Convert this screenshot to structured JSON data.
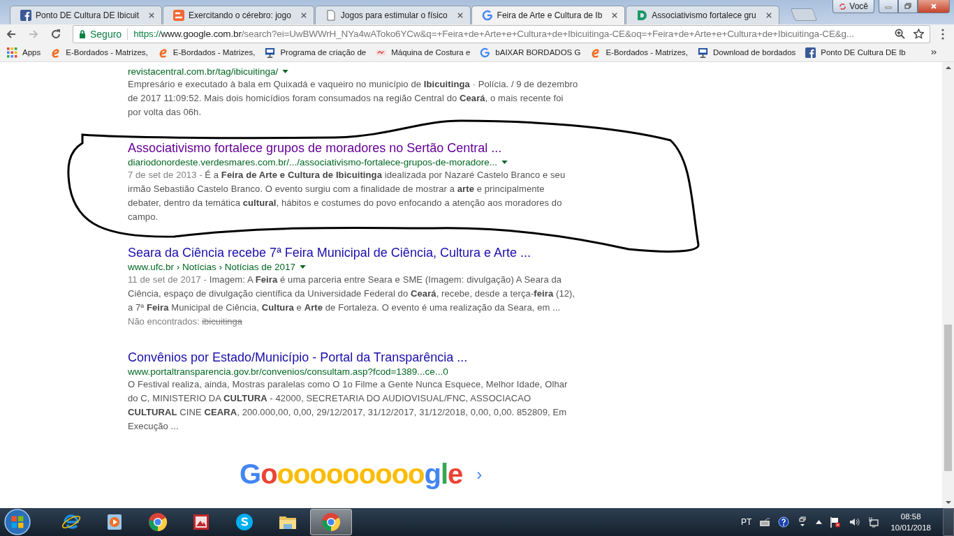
{
  "tabs": [
    {
      "title": "Ponto DE Cultura DE Ibicuit",
      "kind": "facebook",
      "selected": false
    },
    {
      "title": "Exercitando o cérebro: jogo",
      "kind": "blogger",
      "selected": false
    },
    {
      "title": "Jogos para estimular o físico",
      "kind": "page",
      "selected": false
    },
    {
      "title": "Feira de Arte e Cultura de Ib",
      "kind": "google",
      "selected": true
    },
    {
      "title": "Associativismo fortalece gru",
      "kind": "letter",
      "selected": false
    }
  ],
  "profile": {
    "label": "Você"
  },
  "omnibox": {
    "secure_label": "Seguro",
    "scheme": "https://",
    "host": "www.google.com.br",
    "path": "/search?ei=UwBWWrH_NYa4wAToko6YCw&q=+Feira+de+Arte+e+Cultura+de+Ibicuitinga-CE&oq=+Feira+de+Arte+e+Cultura+de+Ibicuitinga-CE&g..."
  },
  "bookmarks": [
    {
      "label": "Apps",
      "kind": "apps"
    },
    {
      "label": "E-Bordados - Matrizes,",
      "kind": "eletter"
    },
    {
      "label": "E-Bordados - Matrizes,",
      "kind": "eletter"
    },
    {
      "label": "Programa de criação de",
      "kind": "monitor"
    },
    {
      "label": "Máquina de Costura e",
      "kind": "sewing"
    },
    {
      "label": "bAIXAR BORDADOS G",
      "kind": "google"
    },
    {
      "label": "E-Bordados - Matrizes,",
      "kind": "eletter"
    },
    {
      "label": "Download de bordados",
      "kind": "monitor"
    },
    {
      "label": "Ponto DE Cultura DE Ib",
      "kind": "facebook"
    }
  ],
  "results": [
    {
      "url": "revistacentral.com.br/tag/ibicuitinga/",
      "menu_arrow": true,
      "snippet": "Empresário e executado à bala em Quixadá e vaqueiro no município de **Ibicuitinga** · Polícia. / 9 de dezembro de 2017 11:09:52. Mais dois homicídios foram consumados na região Central do **Ceará**, o mais recente foi por volta das 06h."
    },
    {
      "title": "Associativismo fortalece grupos de moradores no Sertão Central ...",
      "visited": true,
      "url": "diariodonordeste.verdesmares.com.br/.../associativismo-fortalece-grupos-de-moradore...",
      "menu_arrow": true,
      "date": "7 de set de 2013 - ",
      "snippet": "É a **Feira de Arte e Cultura de Ibicuitinga** idealizada por Nazaré Castelo Branco e seu irmão Sebastião Castelo Branco. O evento surgiu com a finalidade de mostrar a **arte** e principalmente debater, dentro da temática **cultural**, hábitos e costumes do povo enfocando a atenção aos moradores do campo."
    },
    {
      "title": "Seara da Ciência recebe 7ª Feira Municipal de Ciência, Cultura e Arte ...",
      "visited": false,
      "url": "www.ufc.br › Notícias › Notícias de 2017",
      "menu_arrow": true,
      "date": "11 de set de 2017 - ",
      "snippet": "Imagem: A **Feira** é uma parceria entre Seara e SME (Imagem: divulgação) A Seara da Ciência, espaço de divulgação científica da Universidade Federal do **Ceará**, recebe, desde a terça-**feira** (12), a 7ª **Feira** Municipal de Ciência, **Cultura** e **Arte** de Fortaleza. O evento é uma realização da Seara, em ...",
      "missing": {
        "label": "Não encontrados:",
        "term": "ibicuitinga"
      }
    },
    {
      "title": "Convênios por Estado/Município - Portal da Transparência ...",
      "visited": false,
      "url": "www.portaltransparencia.gov.br/convenios/consultam.asp?fcod=1389...ce...0",
      "menu_arrow": false,
      "snippet": "O Festival realiza, ainda, Mostras paralelas como O 1o Filme a Gente Nunca Esquece, Melhor Idade, Olhar do C, MINISTERIO DA **CULTURA** - 42000, SECRETARIA DO AUDIOVISUAL/FNC, ASSOCIACAO **CULTURAL** CINE **CEARA**, 200.000,00, 0,00, 29/12/2017, 31/12/2017, 31/12/2018, 0,00, 0,00. 852809, Em Execução ..."
    }
  ],
  "pager": {
    "logo": "Goooooooooogle",
    "next": "›"
  },
  "taskbar": {
    "apps": [
      {
        "kind": "ie",
        "active": false
      },
      {
        "kind": "media",
        "active": false
      },
      {
        "kind": "chrome",
        "active": false
      },
      {
        "kind": "picture",
        "active": false
      },
      {
        "kind": "skype",
        "active": false
      },
      {
        "kind": "folder",
        "active": false
      },
      {
        "kind": "chrome",
        "active": true
      }
    ],
    "language": "PT",
    "time": "08:58",
    "date": "10/01/2018"
  }
}
